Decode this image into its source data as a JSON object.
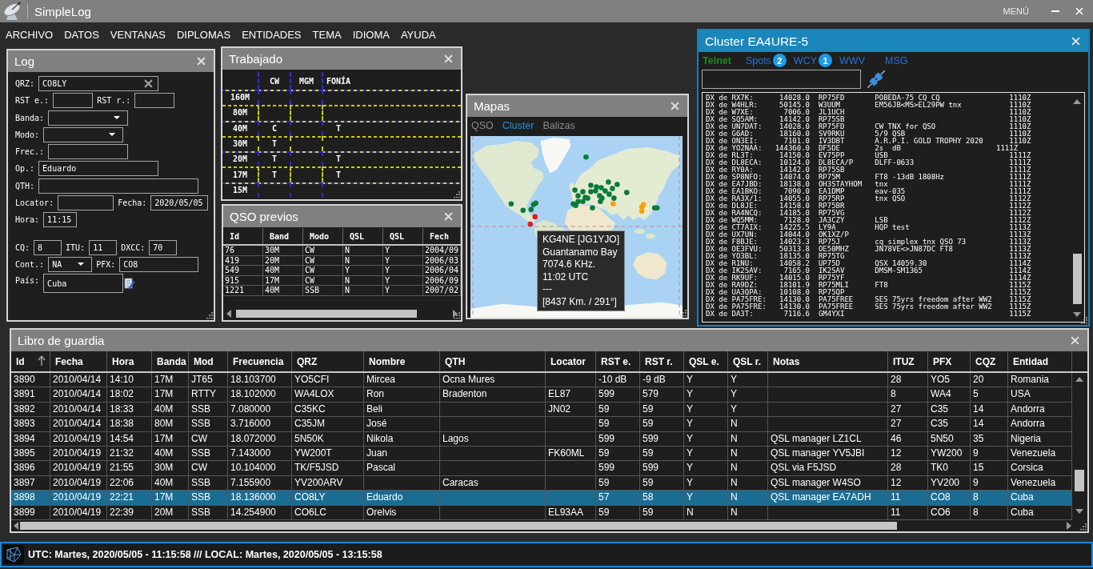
{
  "app": {
    "title": "SimpleLog",
    "menu_button": "MENÚ"
  },
  "menu": [
    "ARCHIVO",
    "DATOS",
    "VENTANAS",
    "DIPLOMAS",
    "ENTIDADES",
    "TEMA",
    "IDIOMA",
    "AYUDA"
  ],
  "log": {
    "title": "Log",
    "qrz": {
      "label": "QRZ:",
      "value": "CO8LY"
    },
    "rst_sent": {
      "label": "RST e.:"
    },
    "rst_received": {
      "label": "RST r.:"
    },
    "band": {
      "label": "Banda:"
    },
    "mode": {
      "label": "Modo:"
    },
    "frequency": {
      "label": "Frec.:"
    },
    "operator": {
      "label": "Op.:",
      "value": "Eduardo"
    },
    "qth": {
      "label": "QTH:"
    },
    "locator": {
      "label": "Locator:"
    },
    "date": {
      "label": "Fecha:",
      "value": "2020/05/05"
    },
    "time": {
      "label": "Hora:",
      "value": "11:15"
    },
    "cq": {
      "label": "CQ:",
      "value": "8"
    },
    "itu": {
      "label": "ITU:",
      "value": "11"
    },
    "dxcc": {
      "label": "DXCC:",
      "value": "70"
    },
    "continent": {
      "label": "Cont.:",
      "value": "NA"
    },
    "prefix": {
      "label": "PFX:",
      "value": "CO8"
    },
    "country": {
      "label": "País:",
      "value": "Cuba"
    }
  },
  "trabajado": {
    "title": "Trabajado",
    "columns": [
      "CW",
      "MGM",
      "FONÍA"
    ],
    "rows": [
      {
        "band": "160M",
        "cells": [
          null,
          null,
          null
        ]
      },
      {
        "band": "80M",
        "cells": [
          null,
          null,
          null
        ]
      },
      {
        "band": "40M",
        "cells": [
          "C",
          null,
          "T"
        ]
      },
      {
        "band": "30M",
        "cells": [
          "T",
          null,
          null
        ]
      },
      {
        "band": "20M",
        "cells": [
          "T",
          null,
          "T"
        ]
      },
      {
        "band": "17M",
        "cells": [
          "T",
          null,
          "T"
        ]
      },
      {
        "band": "15M",
        "cells": [
          null,
          null,
          null
        ]
      }
    ]
  },
  "qso_previos": {
    "title": "QSO previos",
    "columns": [
      "Id",
      "Band",
      "Modo",
      "QSL",
      "QSL",
      "Fech"
    ],
    "rows": [
      [
        "76",
        "30M",
        "CW",
        "N",
        "Y",
        "2004/09"
      ],
      [
        "419",
        "20M",
        "CW",
        "N",
        "Y",
        "2006/03"
      ],
      [
        "549",
        "40M",
        "CW",
        "Y",
        "Y",
        "2006/04"
      ],
      [
        "915",
        "17M",
        "CW",
        "N",
        "Y",
        "2006/09"
      ],
      [
        "1221",
        "40M",
        "SSB",
        "N",
        "Y",
        "2007/02"
      ]
    ]
  },
  "mapas": {
    "title": "Mapas",
    "tabs": [
      {
        "label": "QSO",
        "selected": false
      },
      {
        "label": "Cluster",
        "selected": true
      },
      {
        "label": "Balizas",
        "selected": false
      }
    ],
    "markers": [
      {
        "color": "#0b7a3a"
      },
      {
        "color": "#0b7a3a"
      },
      {
        "color": "#0b7a3a"
      },
      {
        "color": "#0b7a3a"
      },
      {
        "color": "#0b7a3a"
      },
      {
        "color": "#0b7a3a"
      },
      {
        "color": "#0b7a3a"
      },
      {
        "color": "#0b7a3a"
      },
      {
        "color": "#0b7a3a"
      },
      {
        "color": "#0b7a3a"
      },
      {
        "color": "#0b7a3a"
      },
      {
        "color": "#0b7a3a"
      },
      {
        "color": "#0b7a3a"
      },
      {
        "color": "#0b7a3a"
      },
      {
        "color": "#0b7a3a"
      },
      {
        "color": "#0b7a3a"
      },
      {
        "color": "#0b7a3a"
      },
      {
        "color": "#0b7a3a"
      },
      {
        "color": "#0b7a3a"
      },
      {
        "color": "#0b7a3a"
      },
      {
        "color": "#0b7a3a"
      },
      {
        "color": "#0b7a3a"
      },
      {
        "color": "#0b7a3a"
      },
      {
        "color": "#0b7a3a"
      },
      {
        "color": "#0b7a3a"
      },
      {
        "color": "#0b7a3a"
      },
      {
        "color": "#0b7a3a"
      },
      {
        "color": "#0b7a3a"
      },
      {
        "color": "#0b7a3a"
      },
      {
        "color": "#0b7a3a"
      },
      {
        "color": "#0b7a3a"
      },
      {
        "color": "#0b7a3a"
      },
      {
        "color": "#0b7a3a"
      },
      {
        "color": "#f5a200"
      },
      {
        "color": "#f5a200"
      },
      {
        "color": "#f5a200"
      },
      {
        "color": "#f5a200"
      },
      {
        "color": "#e31b23"
      },
      {
        "color": "#e31b23"
      }
    ],
    "tooltip": [
      "KG4NE [JG1YJO]",
      "Guantanamo Bay",
      "7074.6 KHz.",
      "11:02 UTC",
      "---",
      "[8437 Km. / 291°]"
    ]
  },
  "cluster": {
    "title": "Cluster EA4URE-5",
    "tabs": [
      {
        "label": "Telnet",
        "selected": true
      },
      {
        "label": "Spots",
        "badge": "2",
        "selected": false
      },
      {
        "label": "WCY",
        "badge": "1",
        "selected": false
      },
      {
        "label": "WWV",
        "selected": false
      },
      {
        "label": "MSG",
        "selected": false
      }
    ],
    "lines": [
      "DX de RX7K:      14028.0  RP75FD       POBEDA-75 CQ CQ                1110Z",
      "DX de W4HLR:     50145.0  W3UUM        EM56JB<MS>EL29PW tnx           1110Z",
      "DX de W7XE:       7006.0  JL1UCH                                      1110Z",
      "DX de SQ5AM:     14142.0  RP75SB                                      1110Z",
      "DX de UN7DAT:    14028.0  RP75FD       CW TNX for QSO                 1110Z",
      "DX de G6AD:      18160.0  SV9RKU       5/9 QSB                        1110Z",
      "DX de ON3EI:      7101.0  IV3DBT       A.R.P.I. GOLD TROPHY 2020      1110Z",
      "DX de YO2NAA:   144360.0  DF5DE        2s  dB                      1111Z",
      "DX de RL3T:      14150.0  EV75PP       USB                            1111Z",
      "DX de DL8ECA:    10124.0  DL8ECA/P     DLFF-0633                      1111Z",
      "DX de RY0A:      14142.0  RP75SB                                      1111Z",
      "DX de SP8NFO:    14074.0  RP75M        FT8 -13dB 1808Hz               1111Z",
      "DX de EA7JBD:    18138.0  OH3STAYHOM   tnx                            1111Z",
      "DX de EA1BKO:     7090.0  EA1DMP       eav-035                        1111Z",
      "DX de RA3X/1:    14055.0  RP75RP       tnx QSO                        1112Z",
      "DX de DL8JE:     14158.0  RP75BR                                      1112Z",
      "DX de RA4NCQ:    14185.0  RP75VG                                      1112Z",
      "DX de WQ5MM:      7128.0  JA3CZY       LSB                            1112Z",
      "DX de CT7AIX:    14225.5  LY9A         HQP test                       1113Z",
      "DX de UX7UN:     14044.0  OK1XZ/P                                     1113Z",
      "DX de F8BJE:     14023.3  RP75J        cq simplex tnx QSO 73          1113Z",
      "DX de OE3FVU:    50313.8  OE50MHZ      JN78VE<>JN87DC FT8             1113Z",
      "DX de YO3BL:     18135.0  RP75TG                                      1113Z",
      "DX de R1NU:      14058.2  UP75D        QSX 14059.30                   1114Z",
      "DX de IK2SAV:     7165.0  IK2SAV       DMSM-SM1365                    1114Z",
      "DX de RK9UF:     14015.0  RP75YF                                      1114Z",
      "DX de RA9DZ:     18101.9  RP75MLI      FT8                            1115Z",
      "DX de UA3QPA:    10108.0  RP75QP                                      1115Z",
      "DX de PA75FRE:   14130.0  PA75FREE     SES 75yrs freedom after WW2    1115Z",
      "DX de PA75FRE:   14130.0  PA75FREE     SES 75yrs freedom after WW2    1115Z",
      "DX de DA3T:       7116.6  GM4YXI                                      1115Z"
    ]
  },
  "libro": {
    "title": "Libro de guardia",
    "columns": [
      {
        "label": "Id",
        "sorted": true
      },
      {
        "label": "Fecha",
        "sorted": false
      },
      {
        "label": "Hora",
        "sorted": false
      },
      {
        "label": "Banda",
        "sorted": false
      },
      {
        "label": "Mod",
        "sorted": false
      },
      {
        "label": "Frecuencia",
        "sorted": false
      },
      {
        "label": "QRZ",
        "sorted": false
      },
      {
        "label": "Nombre",
        "sorted": false
      },
      {
        "label": "QTH",
        "sorted": false
      },
      {
        "label": "Locator",
        "sorted": false
      },
      {
        "label": "RST e.",
        "sorted": false
      },
      {
        "label": "RST r.",
        "sorted": false
      },
      {
        "label": "QSL e.",
        "sorted": false
      },
      {
        "label": "QSL r.",
        "sorted": false
      },
      {
        "label": "Notas",
        "sorted": false
      },
      {
        "label": "ITUZ",
        "sorted": false
      },
      {
        "label": "PFX",
        "sorted": false
      },
      {
        "label": "CQZ",
        "sorted": false
      },
      {
        "label": "Entidad",
        "sorted": false
      }
    ],
    "rows": [
      {
        "selected": false,
        "cells": [
          "3890",
          "2010/04/14",
          "14:10",
          "17M",
          "JT65",
          "18.103700",
          "YO5CFI",
          "Mircea",
          "Ocna Mures",
          null,
          "-10 dB",
          "-9 dB",
          "Y",
          "Y",
          null,
          "28",
          "YO5",
          "20",
          "Romania"
        ]
      },
      {
        "selected": false,
        "cells": [
          "3891",
          "2010/04/14",
          "18:02",
          "17M",
          "RTTY",
          "18.102000",
          "WA4LOX",
          "Ron",
          "Bradenton",
          "EL87",
          "599",
          "579",
          "Y",
          "Y",
          null,
          "8",
          "WA4",
          "5",
          "USA"
        ]
      },
      {
        "selected": false,
        "cells": [
          "3892",
          "2010/04/14",
          "18:33",
          "40M",
          "SSB",
          "7.080000",
          "C35KC",
          "Beli",
          null,
          "JN02",
          "59",
          "59",
          "Y",
          "Y",
          null,
          "27",
          "C35",
          "14",
          "Andorra"
        ]
      },
      {
        "selected": false,
        "cells": [
          "3893",
          "2010/04/14",
          "18:38",
          "80M",
          "SSB",
          "3.716000",
          "C35JM",
          "José",
          null,
          null,
          "59",
          "59",
          "Y",
          "N",
          null,
          "27",
          "C35",
          "14",
          "Andorra"
        ]
      },
      {
        "selected": false,
        "cells": [
          "3894",
          "2010/04/19",
          "14:54",
          "17M",
          "CW",
          "18.072000",
          "5N50K",
          "Nikola",
          "Lagos",
          null,
          "599",
          "599",
          "Y",
          "N",
          "QSL manager LZ1CL",
          "46",
          "5N50",
          "35",
          "Nigeria"
        ]
      },
      {
        "selected": false,
        "cells": [
          "3895",
          "2010/04/19",
          "21:32",
          "40M",
          "SSB",
          "7.143000",
          "YW200T",
          "Juan",
          null,
          "FK60ML",
          "59",
          "59",
          "Y",
          "N",
          "QSL manager YV5JBI",
          "12",
          "YW200",
          "9",
          "Venezuela"
        ]
      },
      {
        "selected": false,
        "cells": [
          "3896",
          "2010/04/19",
          "21:55",
          "30M",
          "CW",
          "10.104000",
          "TK/F5JSD",
          "Pascal",
          null,
          null,
          "599",
          "599",
          "Y",
          "N",
          "QSL via F5JSD",
          "28",
          "TK0",
          "15",
          "Corsica"
        ]
      },
      {
        "selected": false,
        "cells": [
          "3897",
          "2010/04/19",
          "22:06",
          "40M",
          "SSB",
          "7.155900",
          "YV200ARV",
          null,
          "Caracas",
          null,
          "59",
          "59",
          "Y",
          "N",
          "QSL manager W4SO",
          "12",
          "YV200",
          "9",
          "Venezuela"
        ]
      },
      {
        "selected": true,
        "cells": [
          "3898",
          "2010/04/19",
          "22:21",
          "17M",
          "SSB",
          "18.136000",
          "CO8LY",
          "Eduardo",
          null,
          null,
          "57",
          "58",
          "Y",
          "N",
          "QSL manager EA7ADH",
          "11",
          "CO8",
          "8",
          "Cuba"
        ]
      },
      {
        "selected": false,
        "cells": [
          "3899",
          "2010/04/19",
          "22:39",
          "20M",
          "SSB",
          "14.254900",
          "CO6LC",
          "Orelvis",
          null,
          "EL93AA",
          "59",
          "59",
          "N",
          "N",
          null,
          "11",
          "CO6",
          "8",
          "Cuba"
        ]
      }
    ]
  },
  "status_bar": {
    "text": "UTC: Martes, 2020/05/05 - 11:15:58 /// LOCAL: Martes, 2020/05/05 - 13:15:58"
  }
}
